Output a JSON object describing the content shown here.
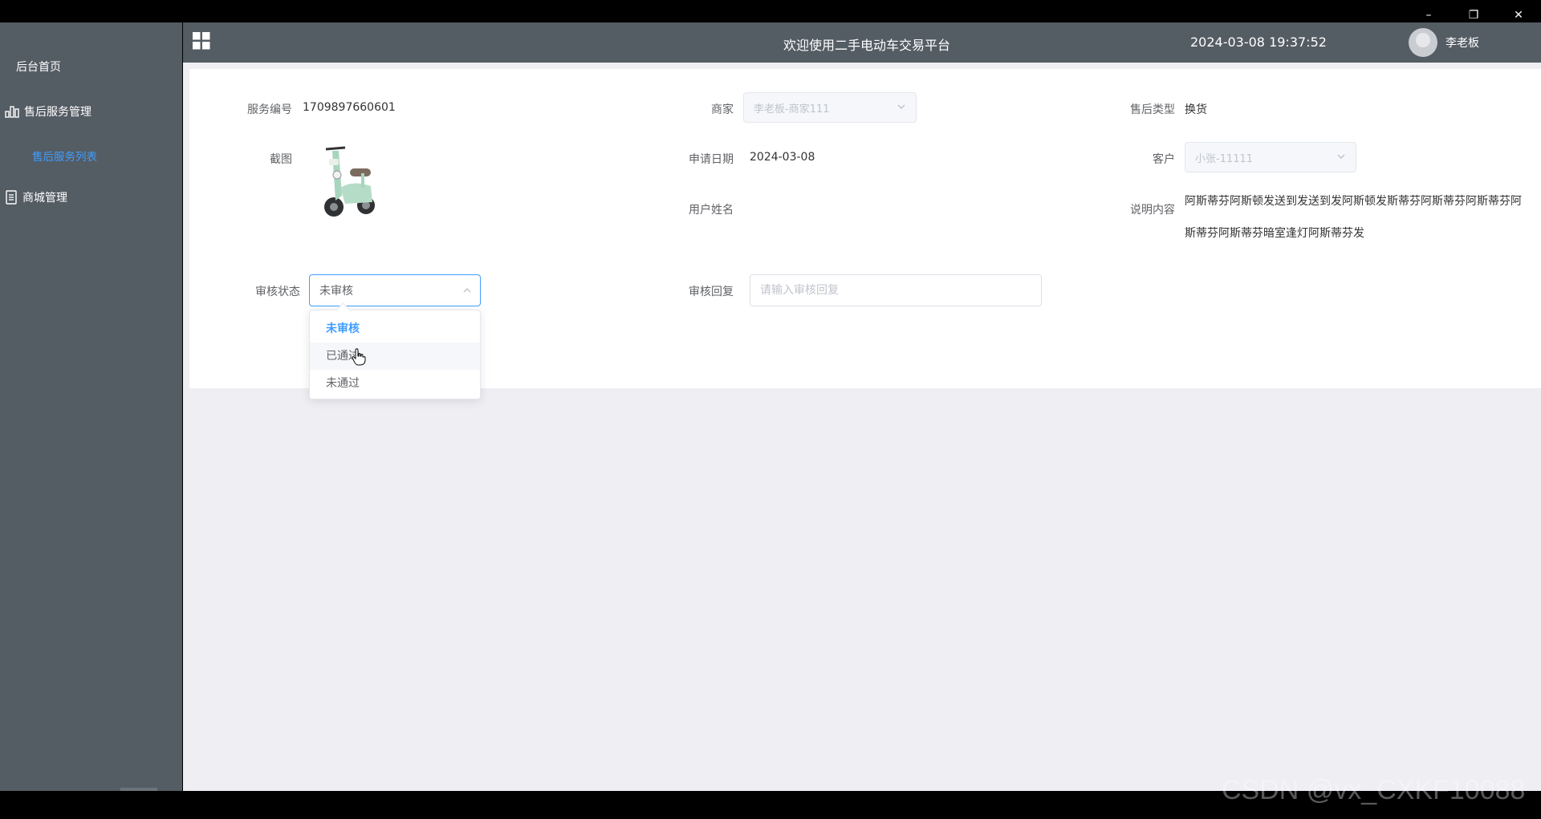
{
  "window": {
    "minimize": "–",
    "restore": "❐",
    "close": "✕"
  },
  "sidebar": {
    "home": "后台首页",
    "after_sales": "售后服务管理",
    "after_sales_list": "售后服务列表",
    "mall": "商城管理"
  },
  "header": {
    "title": "欢迎使用二手电动车交易平台",
    "datetime": "2024-03-08 19:37:52",
    "username": "李老板"
  },
  "form": {
    "service_no_label": "服务编号",
    "service_no": "1709897660601",
    "merchant_label": "商家",
    "merchant_value": "李老板-商家111",
    "type_label": "售后类型",
    "type_value": "换货",
    "screenshot_label": "截图",
    "apply_date_label": "申请日期",
    "apply_date": "2024-03-08",
    "customer_label": "客户",
    "customer_value": "小张-11111",
    "username_label": "用户姓名",
    "username_value": "",
    "desc_label": "说明内容",
    "desc_value": "阿斯蒂芬阿斯顿发送到发送到发阿斯顿发斯蒂芬阿斯蒂芬阿斯蒂芬阿斯蒂芬阿斯蒂芬暗室逢灯阿斯蒂芬发",
    "status_label": "审核状态",
    "status_value": "未审核",
    "reply_label": "审核回复",
    "reply_placeholder": "请输入审核回复",
    "status_options": [
      "未审核",
      "已通过",
      "未通过"
    ]
  },
  "watermark": "CSDN @vx_CXKF10088",
  "colors": {
    "sidebar_bg": "#545c64",
    "accent": "#409eff",
    "content_bg": "#eeeef3"
  }
}
